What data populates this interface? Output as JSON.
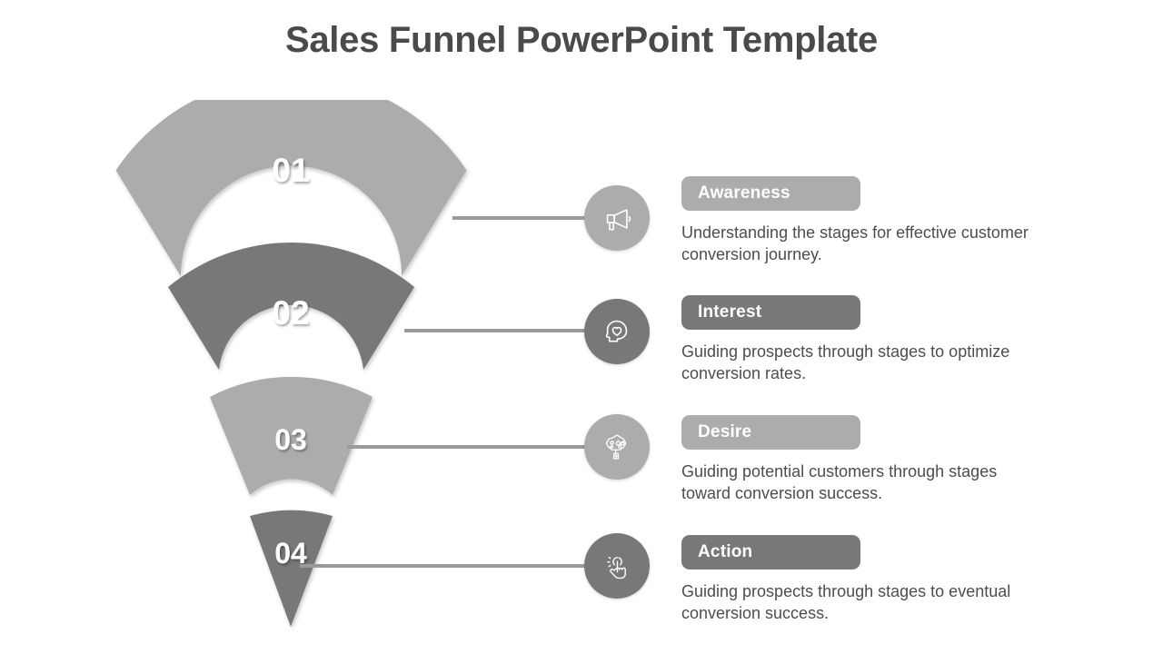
{
  "slide": {
    "title": "Sales Funnel PowerPoint Template",
    "background": "#ffffff",
    "title_color": "#4a4a4a"
  },
  "colors": {
    "light_gray": "#acacac",
    "dark_gray": "#787878",
    "connector": "#9a9a9a",
    "body_text": "#4d4d4d",
    "number_text": "#ffffff"
  },
  "funnel": {
    "segments": [
      {
        "number": "01",
        "fill": "#acacac",
        "icon": "megaphone-icon"
      },
      {
        "number": "02",
        "fill": "#787878",
        "icon": "head-heart-icon"
      },
      {
        "number": "03",
        "fill": "#acacac",
        "icon": "wish-tree-icon"
      },
      {
        "number": "04",
        "fill": "#787878",
        "icon": "hand-tap-icon"
      }
    ]
  },
  "stages": [
    {
      "label": "Awareness",
      "pill_color": "#acacac",
      "icon_color": "#acacac",
      "icon": "megaphone-icon",
      "description": "Understanding the stages for effective customer conversion journey."
    },
    {
      "label": "Interest",
      "pill_color": "#787878",
      "icon_color": "#787878",
      "icon": "head-heart-icon",
      "description": "Guiding prospects through stages to optimize conversion rates."
    },
    {
      "label": "Desire",
      "pill_color": "#acacac",
      "icon_color": "#acacac",
      "icon": "wish-tree-icon",
      "description": "Guiding potential customers through stages toward conversion success."
    },
    {
      "label": "Action",
      "pill_color": "#787878",
      "icon_color": "#787878",
      "icon": "hand-tap-icon",
      "description": "Guiding prospects through stages to eventual conversion success."
    }
  ]
}
